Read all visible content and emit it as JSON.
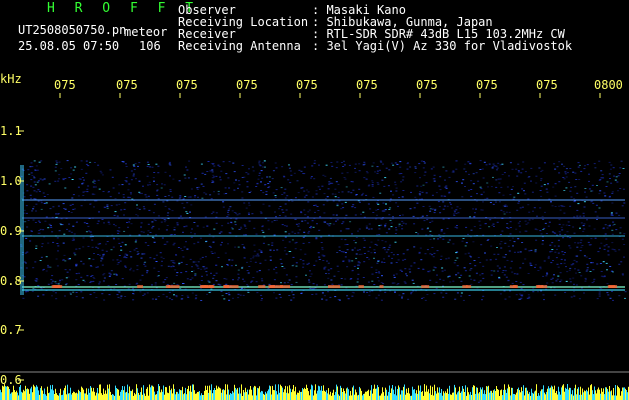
{
  "header": {
    "title": "H R O F F T",
    "filename": "UT2508050750.pn",
    "tag": "meteor",
    "datetime": "25.08.05 07:50",
    "count": "106",
    "meta": [
      {
        "label": "Observer",
        "value": ": Masaki Kano"
      },
      {
        "label": "Receiving Location",
        "value": ": Shibukawa, Gunma, Japan"
      },
      {
        "label": "Receiver",
        "value": ": RTL-SDR SDR# 43dB L15 103.2MHz CW"
      },
      {
        "label": "Receiving Antenna",
        "value": ": 3el Yagi(V) Az 330 for Vladivostok"
      }
    ]
  },
  "axes": {
    "y_unit": "kHz",
    "y_ticks": [
      "1.1",
      "1.0",
      "0.9",
      "0.8",
      "0.7",
      "0.6"
    ],
    "x_ticks": [
      "075",
      "075",
      "075",
      "075",
      "075",
      "075",
      "075",
      "075",
      "075",
      "0800"
    ]
  },
  "colors": {
    "background": "#000000",
    "text_white": "#ffffff",
    "title_green": "#33ff33",
    "axis_yellow": "#ffff66",
    "noise_blue": "#1a2aa8",
    "signal_cyan": "#40e0ff",
    "bar_yellow": "#ffff33",
    "bar_cyan": "#33ddff"
  }
}
